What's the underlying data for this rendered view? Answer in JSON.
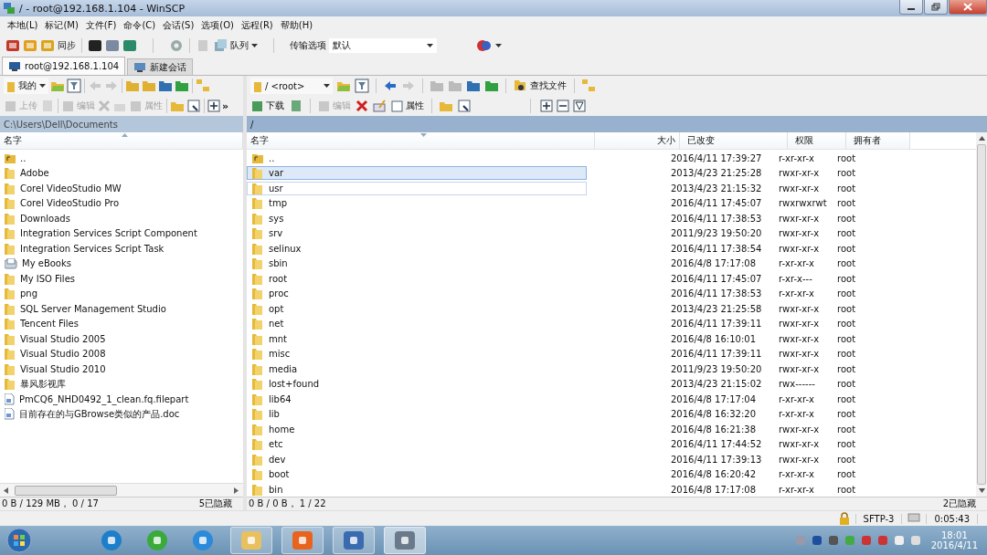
{
  "window": {
    "title": "/ - root@192.168.1.104 - WinSCP"
  },
  "menu": [
    "本地(L)",
    "标记(M)",
    "文件(F)",
    "命令(C)",
    "会话(S)",
    "选项(O)",
    "远程(R)",
    "帮助(H)"
  ],
  "toolbar": {
    "sync": "同步",
    "queue": "队列",
    "transfer_label": "传输选项",
    "transfer_value": "默认"
  },
  "tabs": [
    {
      "label": "root@192.168.1.104",
      "selected": true
    },
    {
      "label": "新建会话",
      "selected": false
    }
  ],
  "left_panel": {
    "location": "我的",
    "upload": {
      "label": "上传",
      "disabled": true
    },
    "edit": {
      "label": "编辑",
      "disabled": true
    },
    "properties": {
      "label": "属性",
      "disabled": true
    },
    "more": "»",
    "path": "C:\\Users\\Dell\\Documents",
    "columns": [
      "名字"
    ],
    "rows": [
      {
        "name": "..",
        "kind": "parent"
      },
      {
        "name": "Adobe",
        "kind": "folder"
      },
      {
        "name": "Corel VideoStudio MW",
        "kind": "folder"
      },
      {
        "name": "Corel VideoStudio Pro",
        "kind": "folder"
      },
      {
        "name": "Downloads",
        "kind": "folder"
      },
      {
        "name": "Integration Services Script Component",
        "kind": "folder"
      },
      {
        "name": "Integration Services Script Task",
        "kind": "folder"
      },
      {
        "name": "My eBooks",
        "kind": "library"
      },
      {
        "name": "My ISO Files",
        "kind": "folder"
      },
      {
        "name": "png",
        "kind": "folder"
      },
      {
        "name": "SQL Server Management Studio",
        "kind": "folder"
      },
      {
        "name": "Tencent Files",
        "kind": "folder"
      },
      {
        "name": "Visual Studio 2005",
        "kind": "folder"
      },
      {
        "name": "Visual Studio 2008",
        "kind": "folder"
      },
      {
        "name": "Visual Studio 2010",
        "kind": "folder"
      },
      {
        "name": "暴风影视库",
        "kind": "folder"
      },
      {
        "name": "PmCQ6_NHD0492_1_clean.fq.filepart",
        "kind": "file"
      },
      {
        "name": "目前存在的与GBrowse类似的产品.doc",
        "kind": "file"
      }
    ],
    "status": "0 B / 129 MB， 0 / 17",
    "hidden": "5已隐藏"
  },
  "right_panel": {
    "location": "/ <root>",
    "download": {
      "label": "下载",
      "disabled": false
    },
    "edit": {
      "label": "编辑",
      "disabled": true
    },
    "properties": {
      "label": "属性",
      "disabled": false
    },
    "find": "查找文件",
    "path": "/",
    "columns": [
      "名字",
      "大小",
      "已改变",
      "权限",
      "拥有者"
    ],
    "rows": [
      {
        "name": "..",
        "kind": "parent",
        "modified": "2016/4/11 17:39:27",
        "rights": "r-xr-xr-x",
        "owner": "root",
        "selected": false,
        "focused": false
      },
      {
        "name": "var",
        "kind": "folder",
        "modified": "2013/4/23 21:25:28",
        "rights": "rwxr-xr-x",
        "owner": "root",
        "selected": true,
        "focused": false
      },
      {
        "name": "usr",
        "kind": "folder",
        "modified": "2013/4/23 21:15:32",
        "rights": "rwxr-xr-x",
        "owner": "root",
        "selected": false,
        "focused": true
      },
      {
        "name": "tmp",
        "kind": "folder",
        "modified": "2016/4/11 17:45:07",
        "rights": "rwxrwxrwt",
        "owner": "root",
        "selected": false,
        "focused": false
      },
      {
        "name": "sys",
        "kind": "folder",
        "modified": "2016/4/11 17:38:53",
        "rights": "rwxr-xr-x",
        "owner": "root",
        "selected": false,
        "focused": false
      },
      {
        "name": "srv",
        "kind": "folder",
        "modified": "2011/9/23 19:50:20",
        "rights": "rwxr-xr-x",
        "owner": "root",
        "selected": false,
        "focused": false
      },
      {
        "name": "selinux",
        "kind": "folder",
        "modified": "2016/4/11 17:38:54",
        "rights": "rwxr-xr-x",
        "owner": "root",
        "selected": false,
        "focused": false
      },
      {
        "name": "sbin",
        "kind": "folder",
        "modified": "2016/4/8 17:17:08",
        "rights": "r-xr-xr-x",
        "owner": "root",
        "selected": false,
        "focused": false
      },
      {
        "name": "root",
        "kind": "folder",
        "modified": "2016/4/11 17:45:07",
        "rights": "r-xr-x---",
        "owner": "root",
        "selected": false,
        "focused": false
      },
      {
        "name": "proc",
        "kind": "folder",
        "modified": "2016/4/11 17:38:53",
        "rights": "r-xr-xr-x",
        "owner": "root",
        "selected": false,
        "focused": false
      },
      {
        "name": "opt",
        "kind": "folder",
        "modified": "2013/4/23 21:25:58",
        "rights": "rwxr-xr-x",
        "owner": "root",
        "selected": false,
        "focused": false
      },
      {
        "name": "net",
        "kind": "folder",
        "modified": "2016/4/11 17:39:11",
        "rights": "rwxr-xr-x",
        "owner": "root",
        "selected": false,
        "focused": false
      },
      {
        "name": "mnt",
        "kind": "folder",
        "modified": "2016/4/8 16:10:01",
        "rights": "rwxr-xr-x",
        "owner": "root",
        "selected": false,
        "focused": false
      },
      {
        "name": "misc",
        "kind": "folder",
        "modified": "2016/4/11 17:39:11",
        "rights": "rwxr-xr-x",
        "owner": "root",
        "selected": false,
        "focused": false
      },
      {
        "name": "media",
        "kind": "folder",
        "modified": "2011/9/23 19:50:20",
        "rights": "rwxr-xr-x",
        "owner": "root",
        "selected": false,
        "focused": false
      },
      {
        "name": "lost+found",
        "kind": "folder",
        "modified": "2013/4/23 21:15:02",
        "rights": "rwx------",
        "owner": "root",
        "selected": false,
        "focused": false
      },
      {
        "name": "lib64",
        "kind": "folder",
        "modified": "2016/4/8 17:17:04",
        "rights": "r-xr-xr-x",
        "owner": "root",
        "selected": false,
        "focused": false
      },
      {
        "name": "lib",
        "kind": "folder",
        "modified": "2016/4/8 16:32:20",
        "rights": "r-xr-xr-x",
        "owner": "root",
        "selected": false,
        "focused": false
      },
      {
        "name": "home",
        "kind": "folder",
        "modified": "2016/4/8 16:21:38",
        "rights": "rwxr-xr-x",
        "owner": "root",
        "selected": false,
        "focused": false
      },
      {
        "name": "etc",
        "kind": "folder",
        "modified": "2016/4/11 17:44:52",
        "rights": "rwxr-xr-x",
        "owner": "root",
        "selected": false,
        "focused": false
      },
      {
        "name": "dev",
        "kind": "folder",
        "modified": "2016/4/11 17:39:13",
        "rights": "rwxr-xr-x",
        "owner": "root",
        "selected": false,
        "focused": false
      },
      {
        "name": "boot",
        "kind": "folder",
        "modified": "2016/4/8 16:20:42",
        "rights": "r-xr-xr-x",
        "owner": "root",
        "selected": false,
        "focused": false
      },
      {
        "name": "bin",
        "kind": "folder",
        "modified": "2016/4/8 17:17:08",
        "rights": "r-xr-xr-x",
        "owner": "root",
        "selected": false,
        "focused": false
      }
    ],
    "status": "0 B / 0 B， 1 / 22",
    "hidden": "2已隐藏"
  },
  "status_bar": {
    "protocol": "SFTP-3",
    "elapsed": "0:05:43"
  },
  "taskbar": {
    "time": "18:01",
    "date": "2016/4/11"
  }
}
